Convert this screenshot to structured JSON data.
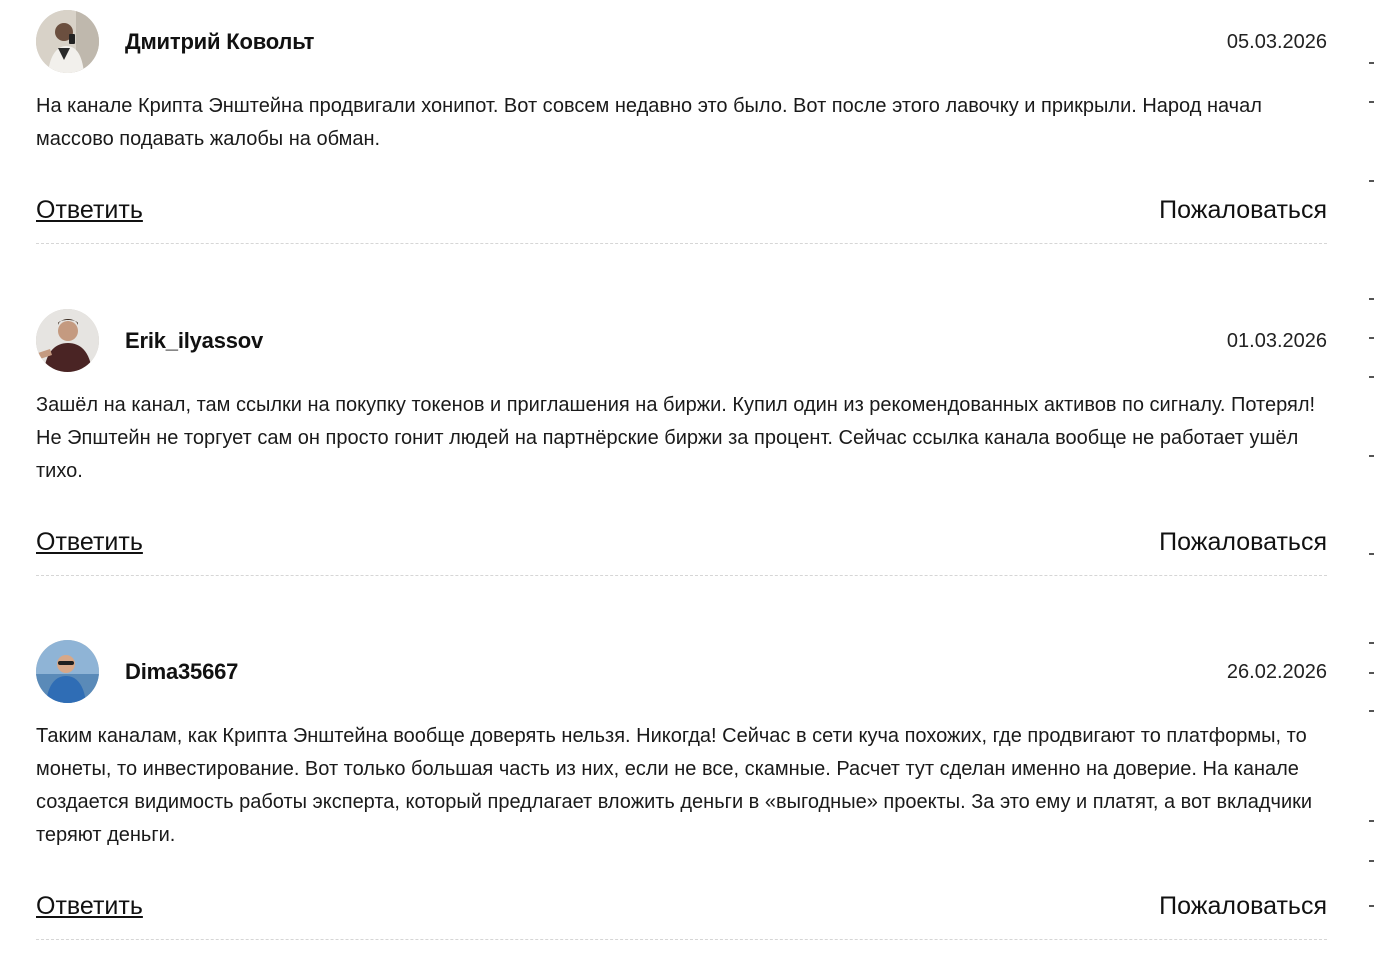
{
  "comments": [
    {
      "author": "Дмитрий Ковольт",
      "date": "05.03.2026",
      "text": "На канале Крипта Энштейна продвигали хонипот. Вот совсем недавно это было. Вот после этого лавочку и прикрыли. Народ начал массово подавать жалобы на обман.",
      "reply_label": "Ответить",
      "report_label": "Пожаловаться",
      "avatar_icon": "user-avatar-photo"
    },
    {
      "author": "Erik_ilyassov",
      "date": "01.03.2026",
      "text": "Зашёл на канал, там ссылки на покупку токенов и приглашения на биржи. Купил один из рекомендованных активов по сигналу. Потерял! Не Эпштейн не торгует сам он просто гонит людей на партнёрские биржи за процент. Сейчас ссылка канала вообще не работает ушёл тихо.",
      "reply_label": "Ответить",
      "report_label": "Пожаловаться",
      "avatar_icon": "user-avatar-photo"
    },
    {
      "author": "Dima35667",
      "date": "26.02.2026",
      "text": "Таким каналам, как Крипта Энштейна вообще доверять нельзя. Никогда! Сейчас в сети куча похожих, где продвигают то платформы, то монеты, то инвестирование. Вот только большая часть из них, если не все, скамные. Расчет тут сделан именно на доверие. На канале создается видимость работы эксперта, который предлагает вложить деньги в «выгодные» проекты. За это ему и платят, а вот вкладчики теряют деньги.",
      "reply_label": "Ответить",
      "report_label": "Пожаловаться",
      "avatar_icon": "user-avatar-photo"
    }
  ]
}
